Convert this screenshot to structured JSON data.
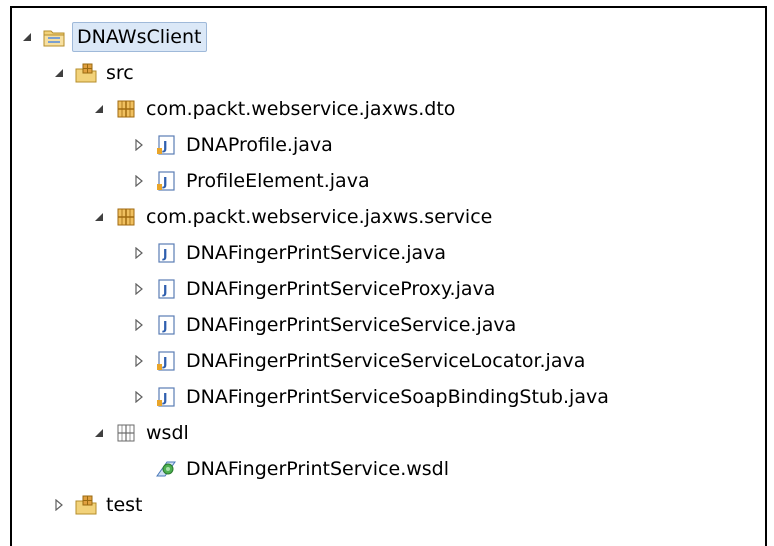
{
  "tree": {
    "project": {
      "label": "DNAWsClient",
      "expanded": true,
      "selected": true
    },
    "src": {
      "label": "src",
      "expanded": true
    },
    "dto_package": {
      "label": "com.packt.webservice.jaxws.dto",
      "expanded": true
    },
    "dto_files": [
      {
        "label": "DNAProfile.java"
      },
      {
        "label": "ProfileElement.java"
      }
    ],
    "service_package": {
      "label": "com.packt.webservice.jaxws.service",
      "expanded": true
    },
    "service_files": [
      {
        "label": "DNAFingerPrintService.java"
      },
      {
        "label": "DNAFingerPrintServiceProxy.java"
      },
      {
        "label": "DNAFingerPrintServiceService.java"
      },
      {
        "label": "DNAFingerPrintServiceServiceLocator.java"
      },
      {
        "label": "DNAFingerPrintServiceSoapBindingStub.java"
      }
    ],
    "wsdl_folder": {
      "label": "wsdl",
      "expanded": true
    },
    "wsdl_file": {
      "label": "DNAFingerPrintService.wsdl"
    },
    "test": {
      "label": "test",
      "expanded": false
    }
  },
  "icons": {
    "project": "project-folder-icon",
    "source_folder": "source-folder-icon",
    "package": "package-icon",
    "java_file": "java-file-icon",
    "folder": "folder-icon",
    "wsdl_file": "wsdl-file-icon"
  },
  "colors": {
    "selection_bg": "#dbe8f7",
    "selection_border": "#9fb9d9",
    "folder_yellow": "#e9c45b",
    "java_blue": "#2f5fae"
  }
}
